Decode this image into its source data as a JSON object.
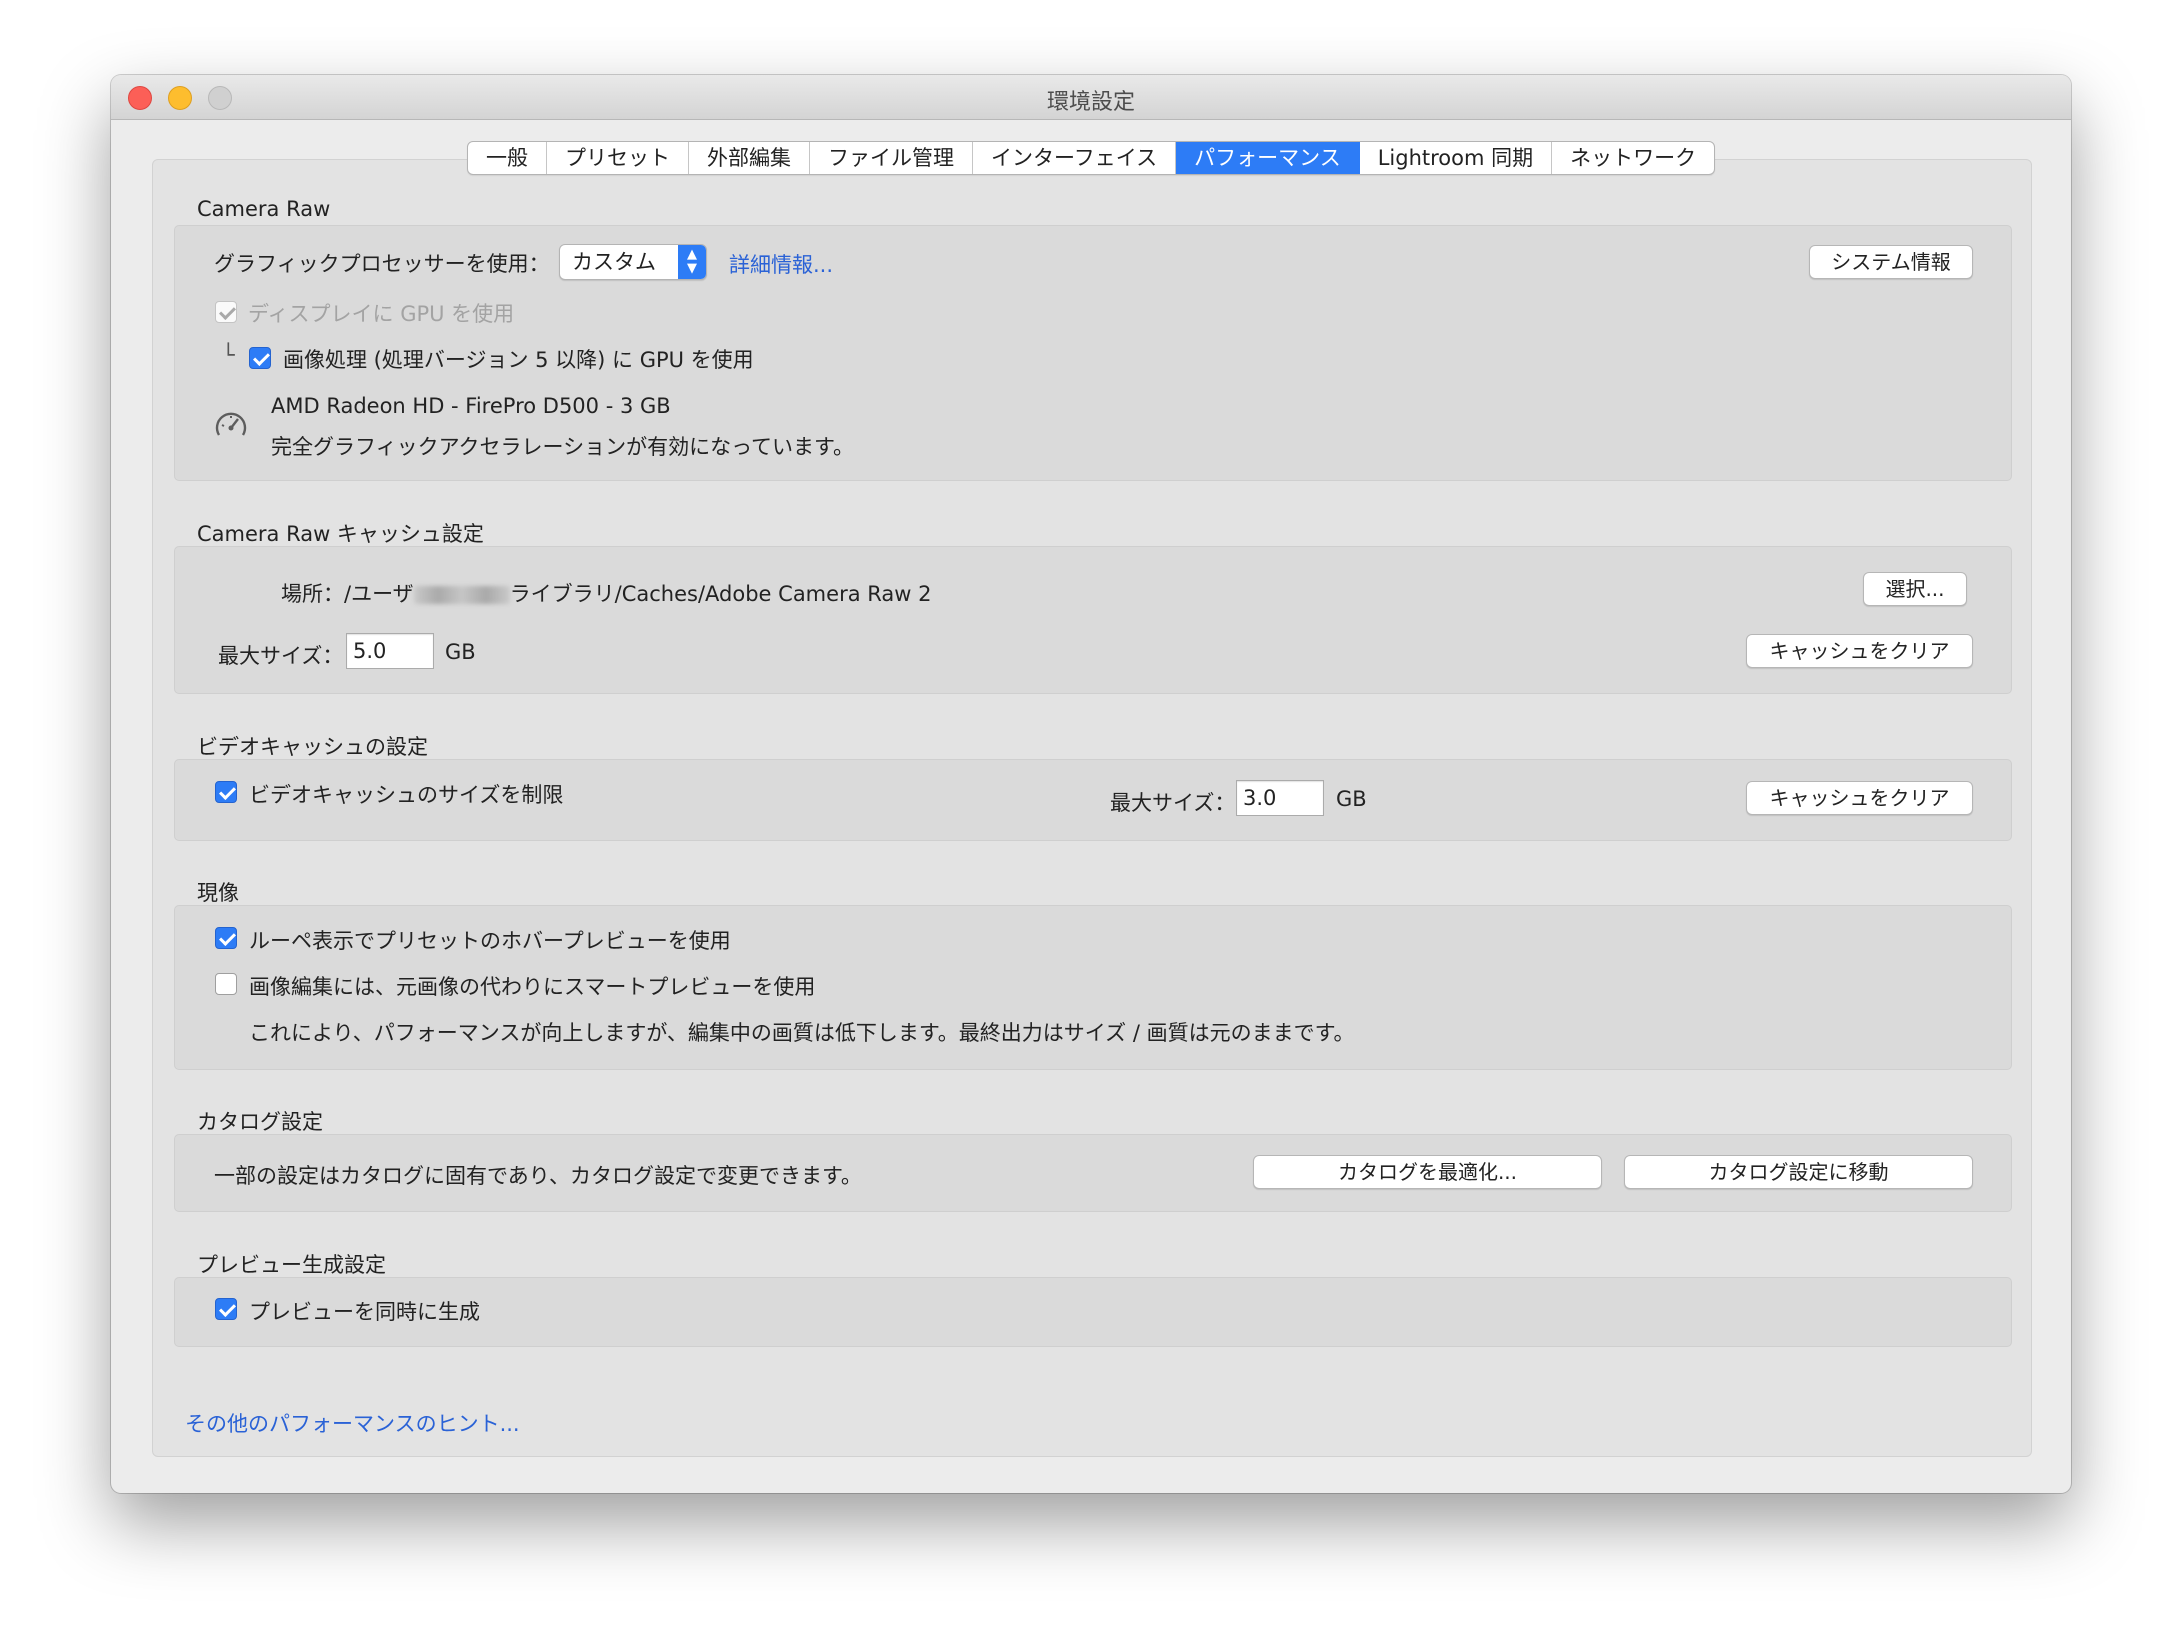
{
  "window": {
    "title": "環境設定"
  },
  "tabs": [
    {
      "label": "一般"
    },
    {
      "label": "プリセット"
    },
    {
      "label": "外部編集"
    },
    {
      "label": "ファイル管理"
    },
    {
      "label": "インターフェイス"
    },
    {
      "label": "パフォーマンス",
      "active": true
    },
    {
      "label": "Lightroom 同期"
    },
    {
      "label": "ネットワーク"
    }
  ],
  "camera_raw": {
    "title": "Camera Raw",
    "gpu_label": "グラフィックプロセッサーを使用：",
    "gpu_select": "カスタム",
    "details_link": "詳細情報...",
    "system_info_button": "システム情報",
    "display_gpu_label": "ディスプレイに GPU を使用",
    "display_gpu_checked": true,
    "image_gpu_prefix": "└",
    "image_gpu_label": "画像処理 (処理バージョン 5 以降) に GPU を使用",
    "image_gpu_checked": true,
    "gpu_name": "AMD Radeon HD - FirePro D500 - 3 GB",
    "gpu_status": "完全グラフィックアクセラレーションが有効になっています。",
    "gauge_icon": "speedometer-icon"
  },
  "cache": {
    "title": "Camera Raw キャッシュ設定",
    "location_prefix": "場所：/ユーザ",
    "location_suffix": "ライブラリ/Caches/Adobe Camera Raw 2",
    "choose_button": "選択...",
    "max_size_label": "最大サイズ：",
    "max_size_value": "5.0",
    "unit": "GB",
    "clear_button": "キャッシュをクリア"
  },
  "video_cache": {
    "title": "ビデオキャッシュの設定",
    "limit_label": "ビデオキャッシュのサイズを制限",
    "limit_checked": true,
    "max_size_label": "最大サイズ：",
    "max_size_value": "3.0",
    "unit": "GB",
    "clear_button": "キャッシュをクリア"
  },
  "develop": {
    "title": "現像",
    "hover_preview_label": "ルーペ表示でプリセットのホバープレビューを使用",
    "hover_preview_checked": true,
    "smart_preview_label": "画像編集には、元画像の代わりにスマートプレビューを使用",
    "smart_preview_checked": false,
    "smart_preview_note": "これにより、パフォーマンスが向上しますが、編集中の画質は低下します。最終出力はサイズ / 画質は元のままです。"
  },
  "catalog": {
    "title": "カタログ設定",
    "description": "一部の設定はカタログに固有であり、カタログ設定で変更できます。",
    "optimize_button": "カタログを最適化...",
    "goto_button": "カタログ設定に移動"
  },
  "preview": {
    "title": "プレビュー生成設定",
    "parallel_label": "プレビューを同時に生成",
    "parallel_checked": true
  },
  "hints_link": "その他のパフォーマンスのヒント..."
}
